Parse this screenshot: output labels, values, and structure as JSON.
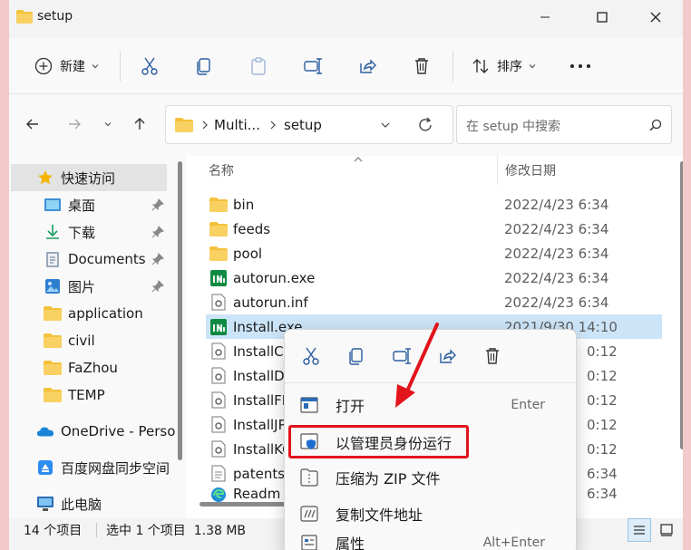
{
  "window": {
    "title": "setup"
  },
  "toolbar": {
    "new_label": "新建",
    "sort_label": "排序"
  },
  "address": {
    "crumbs": [
      "Multi...",
      "setup"
    ]
  },
  "search": {
    "placeholder": "在 setup 中搜索"
  },
  "sidebar": {
    "items": [
      {
        "label": "快速访问",
        "icon": "star-icon"
      },
      {
        "label": "桌面",
        "icon": "desktop-icon",
        "pinned": true
      },
      {
        "label": "下载",
        "icon": "download-icon",
        "pinned": true
      },
      {
        "label": "Documents",
        "icon": "documents-icon",
        "pinned": true
      },
      {
        "label": "图片",
        "icon": "pictures-icon",
        "pinned": true
      },
      {
        "label": "application",
        "icon": "folder-icon"
      },
      {
        "label": "civil",
        "icon": "folder-icon"
      },
      {
        "label": "FaZhou",
        "icon": "folder-icon"
      },
      {
        "label": "TEMP",
        "icon": "folder-icon"
      },
      {
        "label": "OneDrive - Perso",
        "icon": "onedrive-icon"
      },
      {
        "label": "百度网盘同步空间",
        "icon": "baidu-icon"
      },
      {
        "label": "此电脑",
        "icon": "pc-icon"
      }
    ]
  },
  "columns": {
    "name": "名称",
    "date": "修改日期"
  },
  "files": [
    {
      "name": "bin",
      "date": "2022/4/23 6:34",
      "icon": "folder-icon"
    },
    {
      "name": "feeds",
      "date": "2022/4/23 6:34",
      "icon": "folder-icon"
    },
    {
      "name": "pool",
      "date": "2022/4/23 6:34",
      "icon": "folder-icon"
    },
    {
      "name": "autorun.exe",
      "date": "2022/4/23 6:34",
      "icon": "app-icon"
    },
    {
      "name": "autorun.inf",
      "date": "2022/4/23 6:34",
      "icon": "settings-file-icon"
    },
    {
      "name": "Install.exe",
      "date": "2021/9/30 14:10",
      "icon": "app-icon",
      "selected": true
    },
    {
      "name": "InstallCl",
      "date": "0:12",
      "icon": "settings-file-icon"
    },
    {
      "name": "InstallDi",
      "date": "0:12",
      "icon": "settings-file-icon"
    },
    {
      "name": "InstallFF",
      "date": "0:12",
      "icon": "settings-file-icon"
    },
    {
      "name": "InstallJP",
      "date": "0:12",
      "icon": "settings-file-icon"
    },
    {
      "name": "InstallKC",
      "date": "0:12",
      "icon": "settings-file-icon"
    },
    {
      "name": "patents",
      "date": "6:34",
      "icon": "text-file-icon"
    },
    {
      "name": "Readm",
      "date": "6:34",
      "icon": "edge-icon"
    }
  ],
  "status": {
    "count": "14 个项目",
    "selection": "选中 1 个项目  1.38 MB"
  },
  "context_menu": {
    "items": [
      {
        "label": "打开",
        "key": "Enter",
        "icon": "open-icon"
      },
      {
        "label": "以管理员身份运行",
        "key": "",
        "icon": "shield-icon"
      },
      {
        "label": "压缩为 ZIP 文件",
        "key": "",
        "icon": "zip-icon"
      },
      {
        "label": "复制文件地址",
        "key": "",
        "icon": "copy-path-icon"
      },
      {
        "label": "属性",
        "key": "Alt+Enter",
        "icon": "properties-icon"
      }
    ]
  },
  "colors": {
    "highlight": "#e2141c",
    "selection": "#cce4f7",
    "folder": "#f3c13a",
    "app": "#0f8a43"
  }
}
